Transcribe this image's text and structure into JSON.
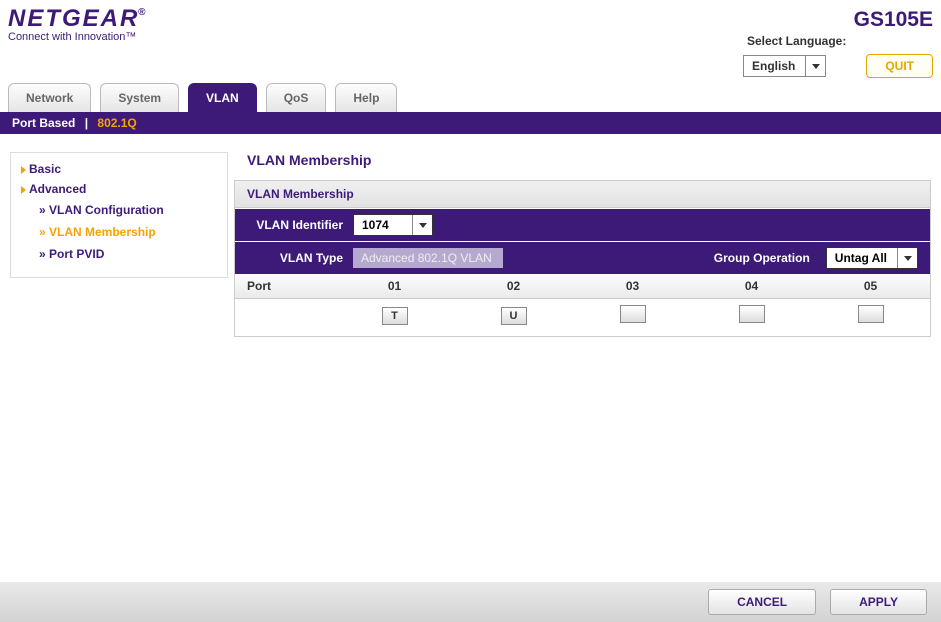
{
  "header": {
    "brand": "NETGEAR",
    "tagline": "Connect with Innovation™",
    "model": "GS105E",
    "lang_label": "Select Language:",
    "lang_value": "English",
    "quit": "QUIT"
  },
  "tabs": [
    "Network",
    "System",
    "VLAN",
    "QoS",
    "Help"
  ],
  "active_tab": 2,
  "subtabs": {
    "items": [
      "Port Based",
      "802.1Q"
    ],
    "active": 1
  },
  "sidebar": {
    "top": [
      "Basic",
      "Advanced"
    ],
    "open_index": 1,
    "subs": [
      "VLAN Configuration",
      "VLAN Membership",
      "Port PVID"
    ],
    "active_sub": 1
  },
  "page_title": "VLAN Membership",
  "panel": {
    "title": "VLAN Membership",
    "vlan_id_label": "VLAN Identifier",
    "vlan_id_value": "1074",
    "vlan_type_label": "VLAN Type",
    "vlan_type_value": "Advanced 802.1Q VLAN",
    "group_op_label": "Group Operation",
    "group_op_value": "Untag All"
  },
  "ports": {
    "header": "Port",
    "cols": [
      "01",
      "02",
      "03",
      "04",
      "05"
    ],
    "state": [
      "T",
      "U",
      "",
      "",
      ""
    ]
  },
  "footer": {
    "cancel": "CANCEL",
    "apply": "APPLY"
  }
}
